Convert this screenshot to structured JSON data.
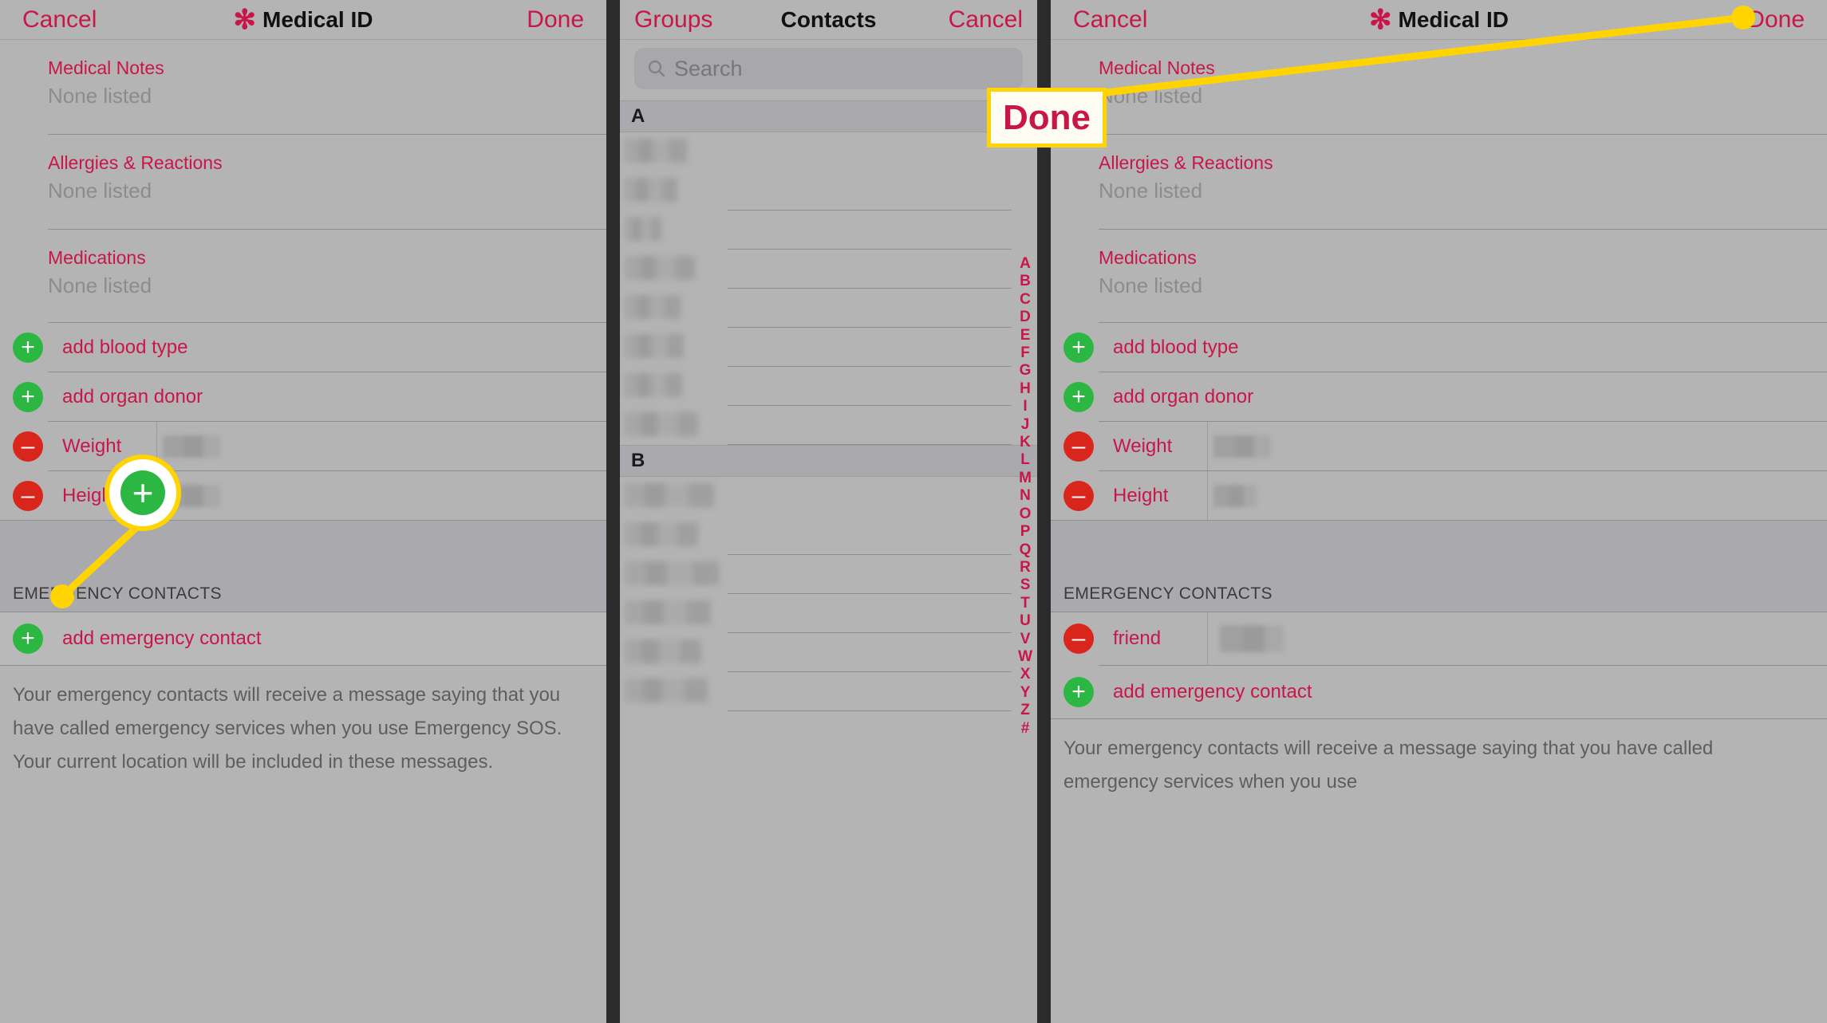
{
  "left_panel": {
    "nav": {
      "cancel": "Cancel",
      "title": "Medical ID",
      "star_icon": "✻",
      "done": "Done"
    },
    "notes": [
      {
        "title": "Medical Notes",
        "value": "None listed"
      },
      {
        "title": "Allergies & Reactions",
        "value": "None listed"
      },
      {
        "title": "Medications",
        "value": "None listed"
      }
    ],
    "rows": [
      {
        "icon": "add",
        "label": "add blood type",
        "has_value": false
      },
      {
        "icon": "add",
        "label": "add organ donor",
        "has_value": false
      },
      {
        "icon": "remove",
        "label": "Weight",
        "has_value": true
      },
      {
        "icon": "remove",
        "label": "Height",
        "has_value": true
      }
    ],
    "emergency_section_title": "EMERGENCY CONTACTS",
    "emergency_rows": [
      {
        "icon": "add",
        "label": "add emergency contact",
        "has_value": false
      }
    ],
    "footer_note": "Your emergency contacts will receive a message saying that you have called emergency services when you use Emergency SOS. Your current location will be included in these messages."
  },
  "mid_panel": {
    "nav": {
      "groups": "Groups",
      "title": "Contacts",
      "cancel": "Cancel"
    },
    "search": {
      "placeholder": "Search",
      "icon": "search-icon",
      "value": ""
    },
    "sections": [
      {
        "letter": "A",
        "rows": 7
      },
      {
        "letter": "B",
        "rows": 6
      }
    ],
    "alpha_index": [
      "A",
      "B",
      "C",
      "D",
      "E",
      "F",
      "G",
      "H",
      "I",
      "J",
      "K",
      "L",
      "M",
      "N",
      "O",
      "P",
      "Q",
      "R",
      "S",
      "T",
      "U",
      "V",
      "W",
      "X",
      "Y",
      "Z",
      "#"
    ]
  },
  "right_panel": {
    "nav": {
      "cancel": "Cancel",
      "title": "Medical ID",
      "star_icon": "✻",
      "done": "Done"
    },
    "notes": [
      {
        "title": "Medical Notes",
        "value": "None listed"
      },
      {
        "title": "Allergies & Reactions",
        "value": "None listed"
      },
      {
        "title": "Medications",
        "value": "None listed"
      }
    ],
    "rows": [
      {
        "icon": "add",
        "label": "add blood type",
        "has_value": false
      },
      {
        "icon": "add",
        "label": "add organ donor",
        "has_value": false
      },
      {
        "icon": "remove",
        "label": "Weight",
        "has_value": true
      },
      {
        "icon": "remove",
        "label": "Height",
        "has_value": true
      }
    ],
    "emergency_section_title": "EMERGENCY CONTACTS",
    "emergency_rows": [
      {
        "icon": "remove",
        "label": "friend",
        "has_value": true
      },
      {
        "icon": "add",
        "label": "add emergency contact",
        "has_value": false
      }
    ],
    "footer_note": "Your emergency contacts will receive a message saying that you have called emergency services when you use"
  },
  "annotations": {
    "left_callout": {
      "type": "magnified-plus-button",
      "icon": "plus-icon"
    },
    "right_callout": {
      "type": "label-box",
      "text": "Done"
    }
  },
  "colors": {
    "accent_red": "#c8164b",
    "add_green": "#2cb742",
    "remove_red": "#d9261c",
    "highlight_yellow": "#ffd400",
    "panel_bg": "#b4b4b4",
    "section_bg": "#aaaaae"
  }
}
